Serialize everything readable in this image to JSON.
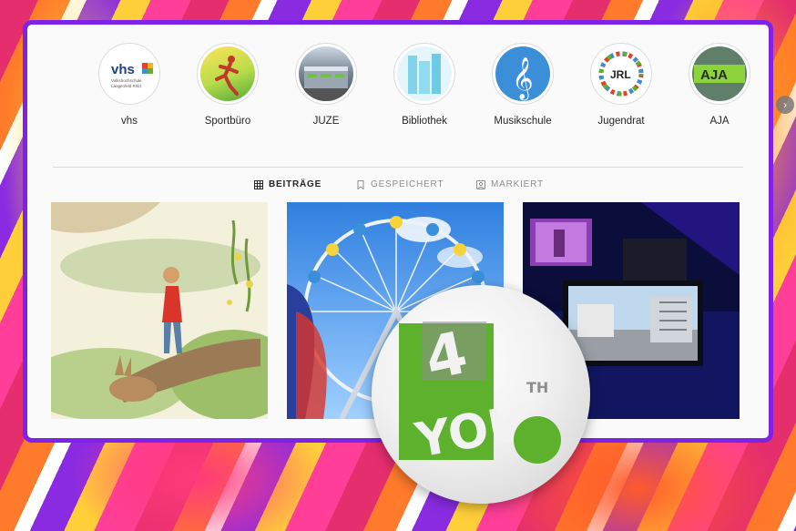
{
  "stories": [
    {
      "label": "vhs",
      "icon": "vhs-logo-icon"
    },
    {
      "label": "Sportbüro",
      "icon": "runner-icon"
    },
    {
      "label": "JUZE",
      "icon": "building-icon"
    },
    {
      "label": "Bibliothek",
      "icon": "bookshelf-icon"
    },
    {
      "label": "Musikschule",
      "icon": "treble-clef-icon"
    },
    {
      "label": "Jugendrat",
      "icon": "jrl-logo-icon"
    },
    {
      "label": "AJA",
      "icon": "aja-logo-icon"
    }
  ],
  "story_logos": {
    "vhs_wordmark": "vhs",
    "vhs_subtitle_1": "Volkshochschule",
    "vhs_subtitle_2": "Langenfeld Rhld.",
    "jrl_wordmark": "JRL",
    "aja_wordmark": "AJA"
  },
  "tabs": {
    "posts": "BEITRÄGE",
    "saved": "GESPEICHERT",
    "tagged": "MARKIERT"
  },
  "badge": {
    "line1": "4",
    "line2": "YOU",
    "superscript": "TH"
  },
  "colors": {
    "frame": "#7d22e6",
    "badge_green": "#5db12d"
  }
}
